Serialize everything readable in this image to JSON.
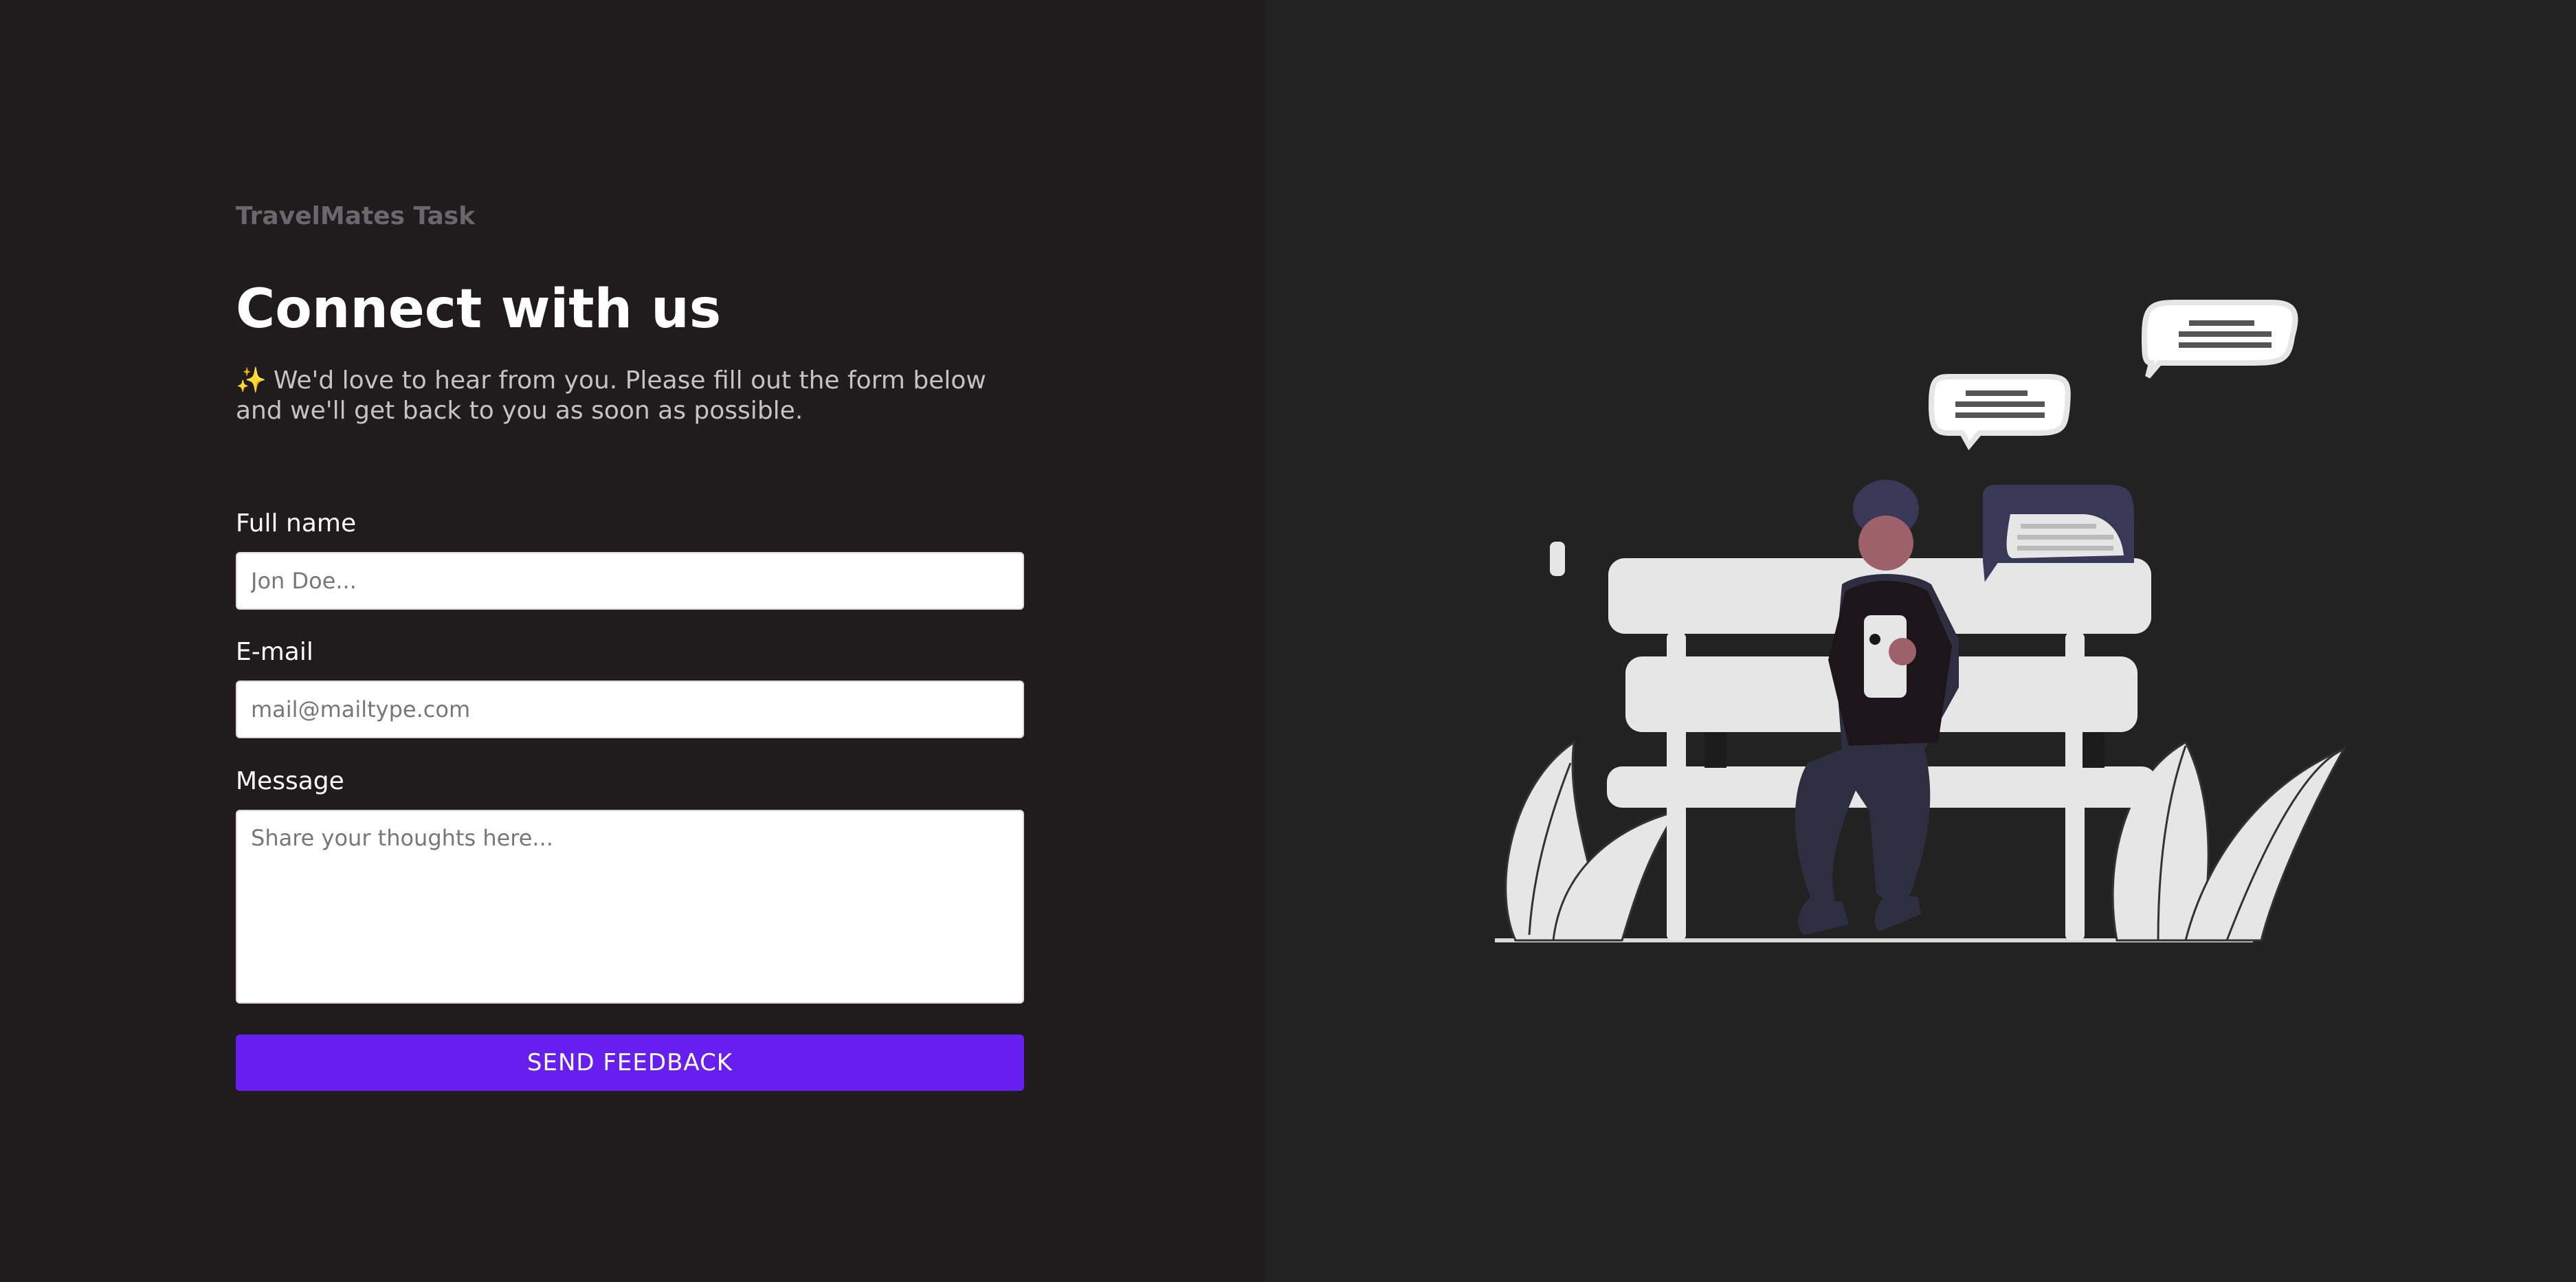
{
  "brand": "TravelMates Task",
  "heading": "Connect with us",
  "intro": {
    "icon": "✨",
    "text": "We'd love to hear from you. Please fill out the form below and we'll get back to you as soon as possible."
  },
  "form": {
    "full_name": {
      "label": "Full name",
      "placeholder": "Jon Doe..."
    },
    "email": {
      "label": "E-mail",
      "placeholder": "mail@mailtype.com"
    },
    "message": {
      "label": "Message",
      "placeholder": "Share your thoughts here..."
    },
    "submit_label": "SEND FEEDBACK"
  },
  "colors": {
    "left_background": "#201b1d",
    "right_background": "#232222",
    "accent": "#661fef"
  }
}
